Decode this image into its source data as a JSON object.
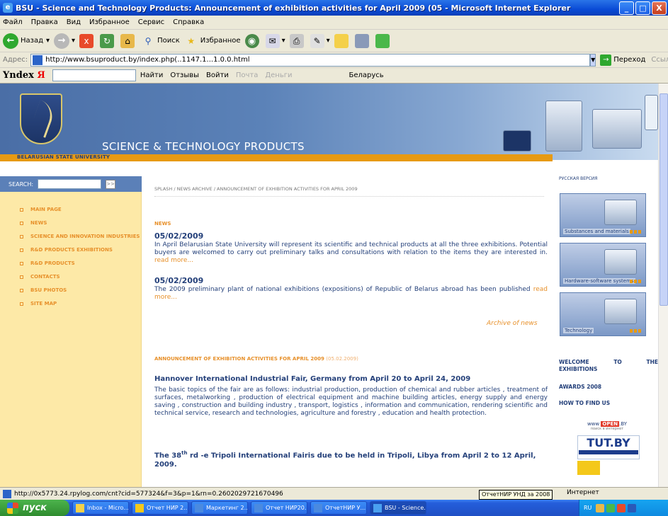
{
  "window": {
    "title": "BSU - Science and Technology Products: Announcement of exhibition activities for April 2009 (05 - Microsoft Internet Explorer",
    "buttons": [
      "_",
      "□",
      "X"
    ]
  },
  "menu": [
    "Файл",
    "Правка",
    "Вид",
    "Избранное",
    "Сервис",
    "Справка"
  ],
  "toolbar": {
    "back": "Назад",
    "search": "Поиск",
    "favorites": "Избранное"
  },
  "address": {
    "label": "Адрес:",
    "url": "http://www.bsuproduct.by/index.php(..1147.1...1.0.0.html",
    "go": "Переход",
    "links": "Ссылки"
  },
  "yandex": {
    "logo_main": "Yndex",
    "logo_r": "Я",
    "find": "Найти",
    "reviews": "Отзывы",
    "login": "Войти",
    "mail": "Почта",
    "money": "Деньги",
    "region": "Беларусь"
  },
  "site": {
    "title": "SCIENCE & TECHNOLOGY PRODUCTS",
    "subtitle": "BELARUSIAN STATE UNIVERSITY",
    "search_label": "SEARCH:",
    "search_go": ">>"
  },
  "nav": [
    "MAIN PAGE",
    "NEWS",
    "SCIENCE AND INNOVATION INDUSTRIES",
    "R&D PRODUCTS EXHIBITIONS",
    "R&D PRODUCTS",
    "CONTACTS",
    "BSU PHOTOS",
    "SITE MAP"
  ],
  "breadcrumb": "SPLASH / NEWS ARCHIVE / ANNOUNCEMENT OF EXHIBITION ACTIVITIES FOR APRIL 2009",
  "news": {
    "heading": "NEWS",
    "items": [
      {
        "date": "05/02/2009",
        "text": "In April Belarusian State University will represent its scientific and technical products at all the three exhibitions. Potential buyers are welcomed to carry out preliminary talks and consultations with relation to the items they are interested in.",
        "more": "read more..."
      },
      {
        "date": "05/02/2009",
        "text": "The 2009 preliminary plant of national exhibitions (expositions) of Republic of Belarus abroad has been published",
        "more": "read more..."
      }
    ],
    "archive": "Archive of news"
  },
  "announcement": {
    "heading": "ANNOUNCEMENT OF EXHIBITION ACTIVITIES FOR APRIL 2009",
    "heading_sub": "(05.02.2009)",
    "fair1_title": "Hannover International Industrial Fair, Germany from April 20 to April 24, 2009",
    "fair1_text": "The basic topics of the fair are as follows: industrial production, production of chemical and rubber articles , treatment of surfaces, metalworking , production of electrical equipment and machine building articles, energy supply and energy saving , construction and building industry , transport, logistics , information and communication, rendering scientific and technical service, research and technologies, agriculture and forestry , education and health protection.",
    "fair2_title_a": "The 38",
    "fair2_sup": "th",
    "fair2_title_b": " rd -e Tripoli International Fairis due to be held in Tripoli, Libya from April 2 to 12 April, 2009."
  },
  "right": {
    "rus": "РУССКАЯ ВЕРСИЯ",
    "cards": [
      "Substances and materials",
      "Hardware-software systems",
      "Technology"
    ],
    "welcome_a": "WELCOME",
    "welcome_b": "TO",
    "welcome_c": "THE",
    "welcome_d": "EXHIBITIONS",
    "awards": "AWARDS 2008",
    "findus": "HOW TO FIND US",
    "open_www": "www",
    "open_open": "OPEN",
    "open_by": ".BY",
    "open_sub": "поиск в интернет",
    "tutby": "TUT.BY"
  },
  "status": {
    "url": "http://0x5773.24.rpylog.com/cnt?cid=577324&f=3&p=1&rn=0.2602029721670496",
    "tooltip": "ОтчетНИР УНД за 2008",
    "zone": "Интернет"
  },
  "taskbar": {
    "start": "пуск",
    "tasks": [
      "Inbox - Micro...",
      "Отчет НИР 2...",
      "Маркетинг 2...",
      "Отчет НИР20...",
      "ОтчетНИР У...",
      "BSU - Science..."
    ],
    "lang": "RU"
  }
}
